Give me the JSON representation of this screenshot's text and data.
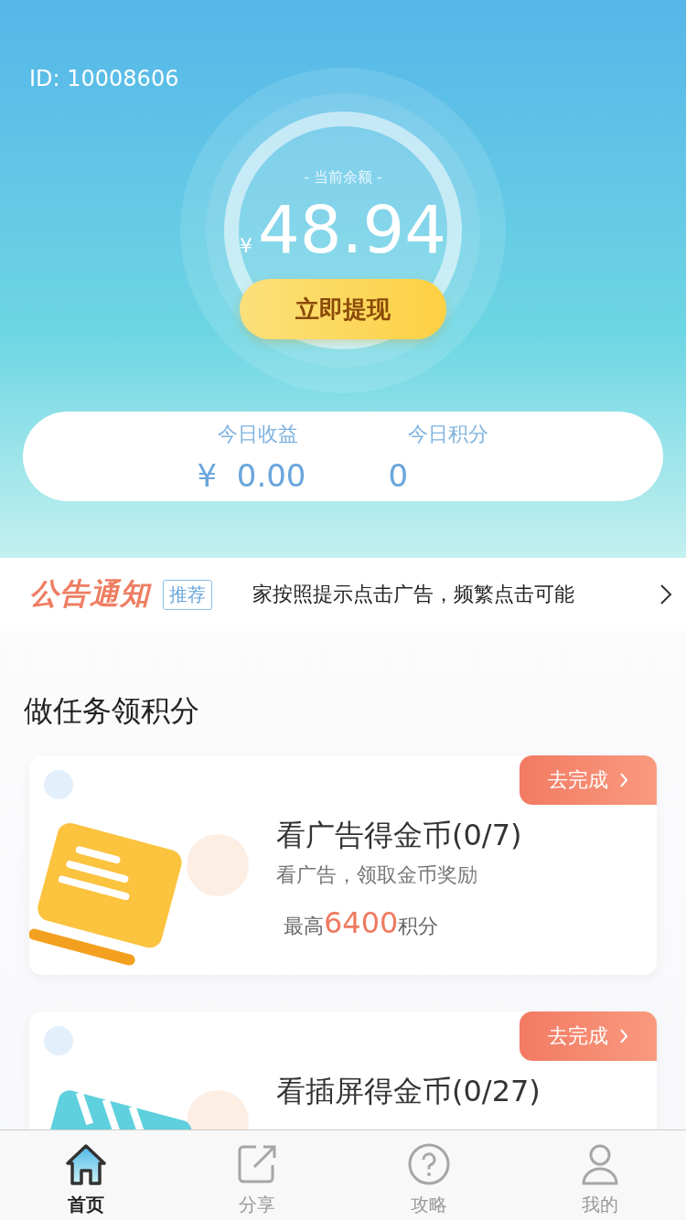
{
  "user_id": "ID: 10008606",
  "balance": {
    "label": "- 当前余额 -",
    "currency": "¥",
    "amount": "48.94",
    "withdraw_button": "立即提现"
  },
  "today_stats": [
    {
      "label": "今日收益",
      "value": "¥  0.00"
    },
    {
      "label": "今日积分",
      "value": "0"
    }
  ],
  "notice": {
    "title": "公告通知",
    "tag": "推荐",
    "text": "家按照提示点击广告，频繁点击可能"
  },
  "section_title": "做任务领积分",
  "tasks": [
    {
      "kind": "document",
      "action": "去完成",
      "title": "看广告得金币(0/7)",
      "subtitle": "看广告，领取金币奖励",
      "reward_prefix": "最高",
      "reward_value": "6400",
      "reward_suffix": "积分"
    },
    {
      "kind": "striped",
      "action": "去完成",
      "title": "看插屏得金币(0/27)"
    }
  ],
  "tabs": [
    {
      "label": "首页",
      "kind": "home",
      "selected": true
    },
    {
      "label": "分享",
      "kind": "share",
      "selected": false
    },
    {
      "label": "攻略",
      "kind": "help",
      "selected": false
    },
    {
      "label": "我的",
      "kind": "user",
      "selected": false
    }
  ]
}
